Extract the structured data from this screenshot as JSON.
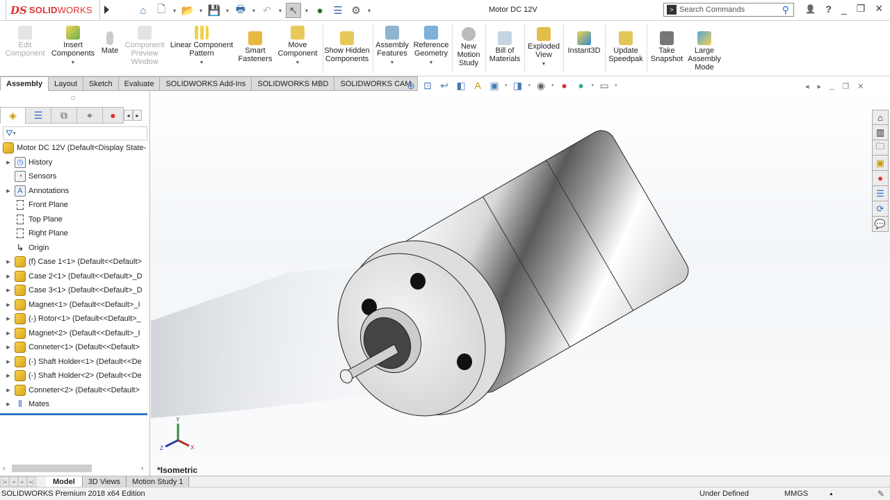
{
  "app": {
    "logo_prefix": "DS",
    "logo_bold": "SOLID",
    "logo_light": "WORKS",
    "document_title": "Motor DC 12V"
  },
  "quick_access": [
    {
      "name": "home-icon",
      "glyph": "⌂"
    },
    {
      "name": "new-document-icon",
      "glyph": "🗋"
    },
    {
      "name": "open-icon",
      "glyph": "📂"
    },
    {
      "name": "save-icon",
      "glyph": "💾"
    },
    {
      "name": "print-icon",
      "glyph": "🖶"
    },
    {
      "name": "undo-icon",
      "glyph": "↶"
    },
    {
      "name": "select-icon",
      "glyph": "↖"
    },
    {
      "name": "rebuild-icon",
      "glyph": "●"
    },
    {
      "name": "file-properties-icon",
      "glyph": "☰"
    },
    {
      "name": "options-icon",
      "glyph": "⚙"
    }
  ],
  "search": {
    "placeholder": "Search Commands"
  },
  "window_controls": {
    "user": "👤",
    "help": "?",
    "minimize": "_",
    "restore": "❐",
    "close": "✕"
  },
  "ribbon": {
    "buttons": [
      {
        "label": "Edit Component",
        "disabled": true
      },
      {
        "label": "Insert Components",
        "dropdown": true
      },
      {
        "label": "Mate"
      },
      {
        "label": "Component Preview Window",
        "disabled": true
      },
      {
        "label": "Linear Component Pattern",
        "dropdown": true
      },
      {
        "label": "Smart Fasteners"
      },
      {
        "label": "Move Component",
        "dropdown": true
      },
      {
        "label": "Show Hidden Components"
      },
      {
        "label": "Assembly Features",
        "dropdown": true
      },
      {
        "label": "Reference Geometry",
        "dropdown": true
      },
      {
        "label": "New Motion Study"
      },
      {
        "label": "Bill of Materials"
      },
      {
        "label": "Exploded View",
        "dropdown": true
      },
      {
        "label": "Instant3D"
      },
      {
        "label": "Update Speedpak"
      },
      {
        "label": "Take Snapshot"
      },
      {
        "label": "Large Assembly Mode"
      }
    ]
  },
  "command_tabs": [
    "Assembly",
    "Layout",
    "Sketch",
    "Evaluate",
    "SOLIDWORKS Add-Ins",
    "SOLIDWORKS MBD",
    "SOLIDWORKS CAM"
  ],
  "active_command_tab": "Assembly",
  "heads_up_toolbar": [
    "zoom-to-fit-icon",
    "zoom-to-area-icon",
    "previous-view-icon",
    "section-view-icon",
    "dynamic-annotation-icon",
    "view-orientation-icon",
    "display-style-icon",
    "hide-show-items-icon",
    "edit-appearance-icon",
    "apply-scene-icon",
    "view-settings-icon"
  ],
  "feature_manager": {
    "tabs": [
      "featuremanager-tab",
      "propertymanager-tab",
      "configurationmanager-tab",
      "dimxpert-tab",
      "display-manager-tab"
    ],
    "root": "Motor DC 12V  (Default<Display State-",
    "items": [
      {
        "label": "History",
        "type": "folder",
        "expandable": true
      },
      {
        "label": "Sensors",
        "type": "folder",
        "expandable": false
      },
      {
        "label": "Annotations",
        "type": "folder",
        "expandable": true
      },
      {
        "label": "Front Plane",
        "type": "plane",
        "expandable": false
      },
      {
        "label": "Top Plane",
        "type": "plane",
        "expandable": false
      },
      {
        "label": "Right Plane",
        "type": "plane",
        "expandable": false
      },
      {
        "label": "Origin",
        "type": "origin",
        "expandable": false
      },
      {
        "label": "(f) Case 1<1> (Default<<Default>",
        "type": "component",
        "expandable": true
      },
      {
        "label": "Case 2<1> (Default<<Default>_D",
        "type": "component",
        "expandable": true
      },
      {
        "label": "Case 3<1> (Default<<Default>_D",
        "type": "component",
        "expandable": true
      },
      {
        "label": "Magnet<1> (Default<<Default>_I",
        "type": "component",
        "expandable": true
      },
      {
        "label": "(-) Rotor<1> (Default<<Default>_",
        "type": "component",
        "expandable": true
      },
      {
        "label": "Magnet<2> (Default<<Default>_I",
        "type": "component",
        "expandable": true
      },
      {
        "label": "Conneter<1> (Default<<Default>",
        "type": "component",
        "expandable": true
      },
      {
        "label": "(-) Shaft Holder<1> (Default<<De",
        "type": "component",
        "expandable": true
      },
      {
        "label": "(-) Shaft Holder<2> (Default<<De",
        "type": "component",
        "expandable": true
      },
      {
        "label": "Conneter<2> (Default<<Default>",
        "type": "component",
        "expandable": true
      },
      {
        "label": "Mates",
        "type": "mates",
        "expandable": true
      }
    ]
  },
  "viewport": {
    "view_name": "*Isometric",
    "triad": {
      "x": "X",
      "y": "Y",
      "z": "Z"
    },
    "task_pane": [
      "solidworks-resources-icon",
      "design-library-icon",
      "file-explorer-icon",
      "view-palette-icon",
      "appearances-icon",
      "custom-properties-icon",
      "solidworks-forum-icon",
      "community-icon"
    ]
  },
  "bottom_tabs": [
    "Model",
    "3D Views",
    "Motion Study 1"
  ],
  "active_bottom_tab": "Model",
  "status": {
    "edition": "SOLIDWORKS Premium 2018 x64 Edition",
    "definition": "Under Defined",
    "units": "MMGS",
    "units_arrow": "▲"
  }
}
